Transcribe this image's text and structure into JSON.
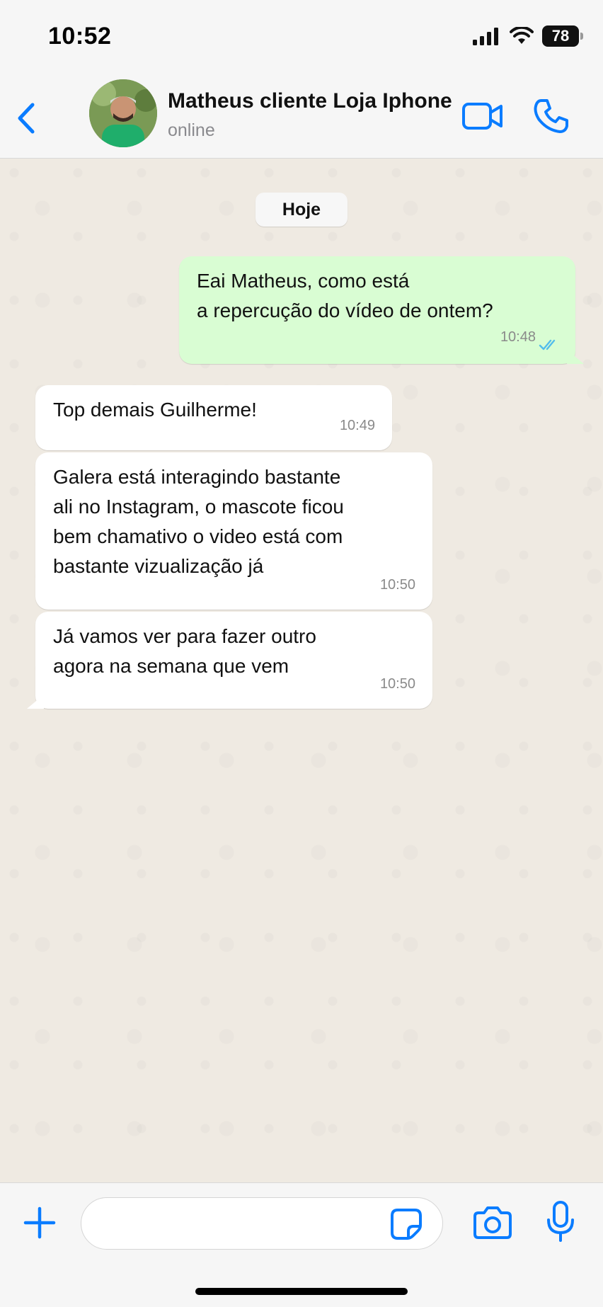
{
  "status_bar": {
    "time": "10:52",
    "battery": "78",
    "icons": [
      "signal-icon",
      "wifi-icon",
      "battery-icon"
    ]
  },
  "header": {
    "contact_name": "Matheus cliente Loja Iphone",
    "contact_status": "online",
    "icons": [
      "chevron-left-icon",
      "video-call-icon",
      "phone-icon"
    ]
  },
  "chat": {
    "date_separator": "Hoje",
    "messages": [
      {
        "direction": "outgoing",
        "text": "Eai Matheus, como está\na repercução do vídeo de ontem?",
        "time": "10:48",
        "status": "read"
      },
      {
        "direction": "incoming",
        "text": "Top demais Guilherme!",
        "time": "10:49"
      },
      {
        "direction": "incoming",
        "text": "Galera está interagindo bastante\nali no Instagram, o mascote ficou\nbem chamativo o video está com\nbastante vizualização já",
        "time": "10:50"
      },
      {
        "direction": "incoming",
        "text": "Já vamos ver para fazer outro\nagora na semana que vem",
        "time": "10:50"
      }
    ]
  },
  "input_bar": {
    "message_value": "",
    "icons": [
      "plus-icon",
      "sticker-icon",
      "camera-icon",
      "microphone-icon"
    ]
  },
  "colors": {
    "accent": "#0a7cff",
    "outgoing_bubble": "#d9fdd3",
    "incoming_bubble": "#ffffff",
    "chat_background": "#efeae2",
    "read_ticks": "#53bdeb"
  }
}
